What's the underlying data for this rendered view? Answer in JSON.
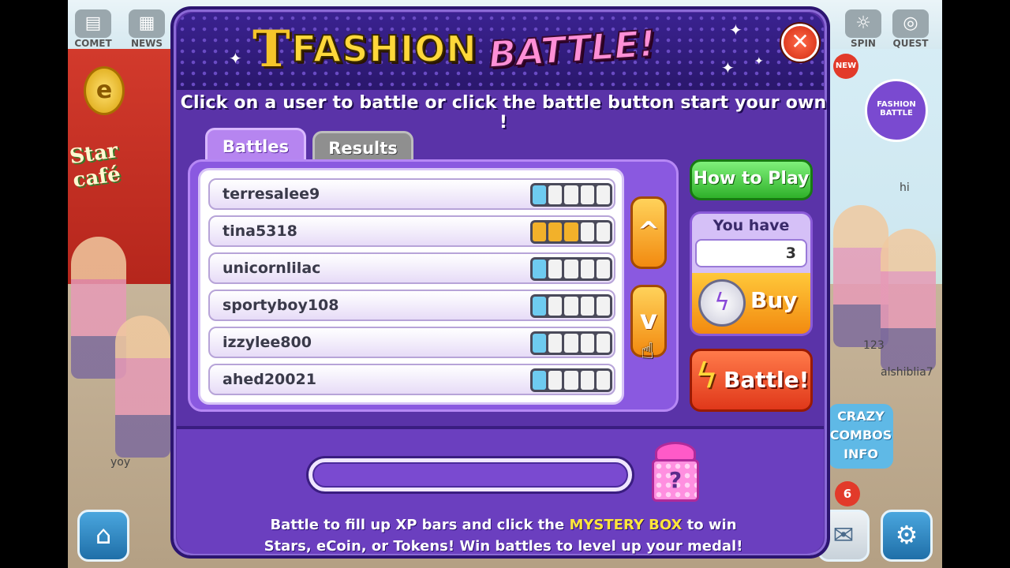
{
  "background": {
    "top_icons": [
      {
        "label": "COMET",
        "icon": "book-icon"
      },
      {
        "label": "NEWS",
        "icon": "newspaper-icon"
      },
      {
        "label": "SPIN",
        "icon": "spin-wheel-icon"
      },
      {
        "label": "QUEST",
        "icon": "quest-icon"
      }
    ],
    "new_badge": "NEW",
    "fashion_battle_sign": "FASHION BATTLE",
    "cafe_coin": "e",
    "cafe_sign": "Star café",
    "chat_hi": "hi",
    "username_right": "alshiblia7",
    "username_num": "123",
    "username_left": "yoy",
    "combo_label": "CRAZY COMBOS INFO",
    "mail_badge": "6"
  },
  "dialog": {
    "title_t": "T",
    "title_fashion": "FASHION",
    "title_battle": "BATTLE!",
    "close": "✕",
    "instruction": "Click on a user to battle or click the battle button start your own !",
    "tabs": {
      "battles": "Battles",
      "results": "Results"
    },
    "battles": [
      {
        "name": "terresalee9",
        "xp_filled": 1,
        "color": "blue"
      },
      {
        "name": "tina5318",
        "xp_filled": 3,
        "color": "orange"
      },
      {
        "name": "unicornlilac",
        "xp_filled": 1,
        "color": "blue"
      },
      {
        "name": "sportyboy108",
        "xp_filled": 1,
        "color": "blue"
      },
      {
        "name": "izzylee800",
        "xp_filled": 1,
        "color": "blue"
      },
      {
        "name": "ahed20021",
        "xp_filled": 1,
        "color": "blue"
      }
    ],
    "xp_segments": 5,
    "scroll_up": "^",
    "scroll_down": "v",
    "how_to_play": "How to Play",
    "you_have_label": "You have",
    "you_have_value": "3",
    "buy_label": "Buy",
    "battle_label": "Battle!",
    "xp_progress": 0,
    "mystery_box_symbol": "?",
    "footer_line1_a": "Battle to fill up XP bars and click the ",
    "footer_line1_hl": "MYSTERY BOX",
    "footer_line1_b": " to win",
    "footer_line2": "Stars, eCoin, or Tokens! Win battles to level up your medal!"
  },
  "colors": {
    "dialog_bg": "#5a33a8",
    "xp_blue": "#6ecbf0",
    "xp_orange": "#f2b12a",
    "highlight": "#ffe63a"
  }
}
